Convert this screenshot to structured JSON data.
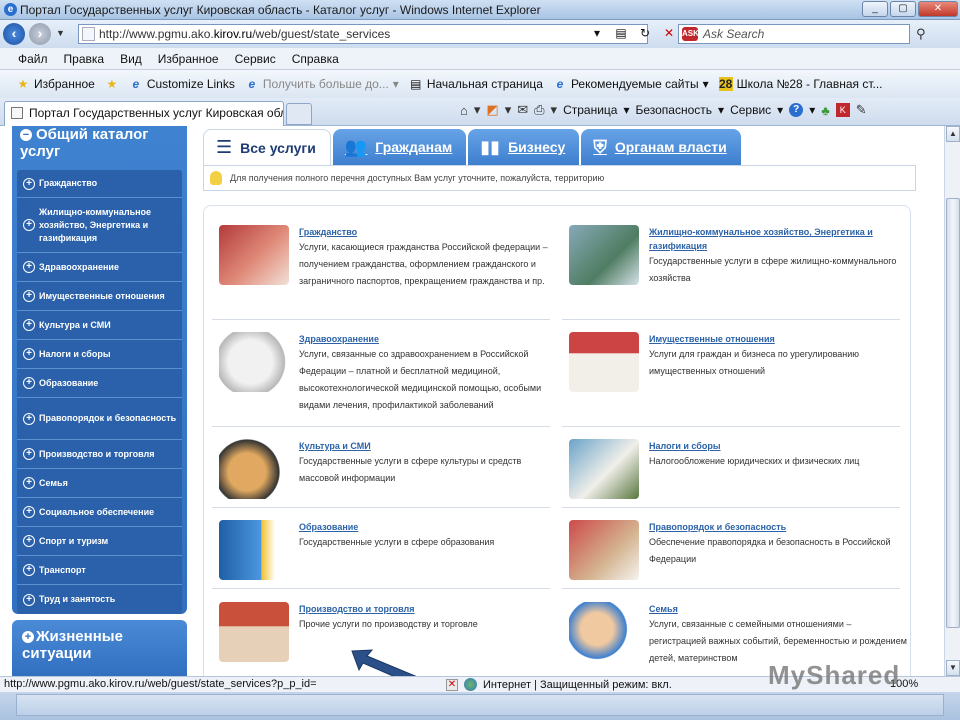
{
  "window": {
    "title": "Портал Государственных услуг Кировская область - Каталог услуг - Windows Internet Explorer"
  },
  "address": {
    "url_prefix": "http://www.pgmu.ako.",
    "url_host": "kirov.ru",
    "url_suffix": "/web/guest/state_services",
    "search_placeholder": "Ask Search"
  },
  "menu": [
    "Файл",
    "Правка",
    "Вид",
    "Избранное",
    "Сервис",
    "Справка"
  ],
  "favorites": {
    "label": "Избранное",
    "links": [
      {
        "label": "Customize Links",
        "icon": "ie-page-icon"
      },
      {
        "label": "Получить больше до...",
        "icon": "ie-page-icon",
        "disabled": true
      },
      {
        "label": "Начальная страница",
        "icon": "ie-page-icon"
      },
      {
        "label": "Рекомендуемые сайты",
        "icon": "ie-e-icon"
      },
      {
        "label": "Школа №28 - Главная ст...",
        "icon": "number-28-icon",
        "badge": "28"
      }
    ]
  },
  "tab": {
    "title": "Портал Государственных услуг Кировская обл..."
  },
  "commands": {
    "page": "Страница",
    "safety": "Безопасность",
    "tools": "Сервис"
  },
  "sidebar": {
    "title": "Общий каталог услуг",
    "items": [
      {
        "label": "Гражданство"
      },
      {
        "label": "Жилищно-коммунальное хозяйство, Энергетика и газификация"
      },
      {
        "label": "Здравоохранение"
      },
      {
        "label": "Имущественные отношения"
      },
      {
        "label": "Культура и СМИ"
      },
      {
        "label": "Налоги и сборы"
      },
      {
        "label": "Образование"
      },
      {
        "label": "Правопорядок и безопасность"
      },
      {
        "label": "Производство и торговля"
      },
      {
        "label": "Семья"
      },
      {
        "label": "Социальное обеспечение"
      },
      {
        "label": "Спорт и туризм"
      },
      {
        "label": "Транспорт"
      },
      {
        "label": "Труд и занятость"
      }
    ],
    "life_situations": "Жизненные ситуации"
  },
  "service_tabs": [
    {
      "label": "Все услуги",
      "active": true,
      "icon": "list-icon"
    },
    {
      "label": "Гражданам",
      "active": false,
      "icon": "people-icon"
    },
    {
      "label": "Бизнесу",
      "active": false,
      "icon": "bar-chart-icon"
    },
    {
      "label": "Органам власти",
      "active": false,
      "icon": "coat-of-arms-icon"
    }
  ],
  "notice": "Для получения полного перечня доступных Вам услуг уточните, пожалуйста, территорию",
  "services": [
    {
      "name": "Гражданство",
      "desc": "Услуги, касающиеся гражданства Российской федерации – получением гражданства, оформлением гражданского и заграничного паспортов, прекращением гражданства и пр.",
      "image": "passport-image"
    },
    {
      "name": "Жилищно-коммунальное хозяйство, Энергетика и газификация",
      "desc": "Государственные услуги в сфере жилищно-коммунального хозяйства",
      "image": "utilities-image"
    },
    {
      "name": "Здравоохранение",
      "desc": "Услуги, связанные со здравоохранением в Российской Федерации – платной и бесплатной медициной, высокотехнологической медицинской помощью, особыми видами лечения, профилактикой заболеваний",
      "image": "medkit-image"
    },
    {
      "name": "Имущественные отношения",
      "desc": "Услуги для граждан и бизнеса по урегулированию имущественных отношений",
      "image": "house-image"
    },
    {
      "name": "Культура и СМИ",
      "desc": "Государственные услуги в сфере культуры и средств массовой информации",
      "image": "palette-image"
    },
    {
      "name": "Налоги и сборы",
      "desc": "Налогообложение юридических и физических лиц",
      "image": "money-image"
    },
    {
      "name": "Образование",
      "desc": "Государственные услуги в сфере образования",
      "image": "book-image"
    },
    {
      "name": "Правопорядок и безопасность",
      "desc": "Обеспечение правопорядка и безопасность в Российской Федерации",
      "image": "law-image"
    },
    {
      "name": "Производство и торговля",
      "desc": "Прочие услуги по производству и торговле",
      "image": "factory-image"
    },
    {
      "name": "Семья",
      "desc": "Услуги, связанные с семейными отношениями – регистрацией важных событий, беременностью и рождением детей, материнством",
      "image": "family-image"
    }
  ],
  "status": {
    "url": "http://www.pgmu.ako.kirov.ru/web/guest/state_services?p_p_id=",
    "zone": "Интернет | Защищенный режим: вкл.",
    "zoom": "100%"
  },
  "watermark": "MyShared"
}
